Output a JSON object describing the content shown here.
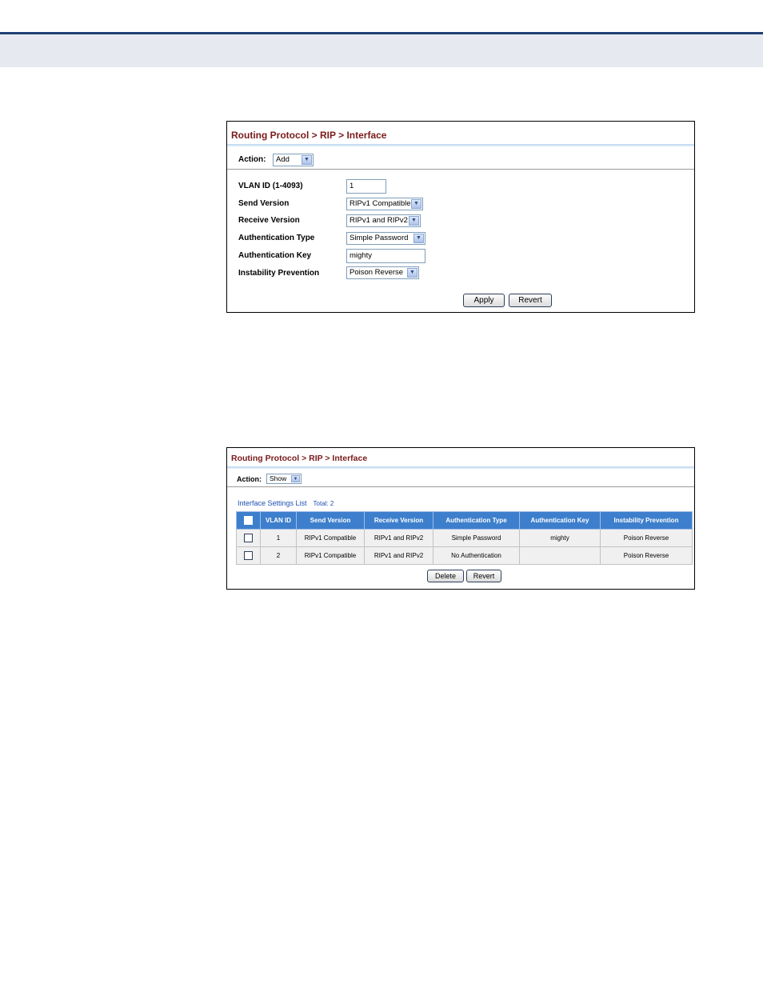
{
  "panel1": {
    "breadcrumb": "Routing Protocol > RIP > Interface",
    "action_label": "Action:",
    "action_value": "Add",
    "fields": {
      "vlan_label": "VLAN ID (1-4093)",
      "vlan_value": "1",
      "send_label": "Send Version",
      "send_value": "RIPv1 Compatible",
      "receive_label": "Receive Version",
      "receive_value": "RIPv1 and RIPv2",
      "auth_type_label": "Authentication Type",
      "auth_type_value": "Simple Password",
      "auth_key_label": "Authentication Key",
      "auth_key_value": "mighty",
      "instability_label": "Instability Prevention",
      "instability_value": "Poison Reverse"
    },
    "apply_label": "Apply",
    "revert_label": "Revert"
  },
  "panel2": {
    "breadcrumb": "Routing Protocol > RIP > Interface",
    "action_label": "Action:",
    "action_value": "Show",
    "list_title": "Interface Settings List",
    "total": "Total: 2",
    "columns": [
      "VLAN ID",
      "Send Version",
      "Receive Version",
      "Authentication Type",
      "Authentication Key",
      "Instability Prevention"
    ],
    "rows": [
      [
        "1",
        "RIPv1 Compatible",
        "RIPv1 and RIPv2",
        "Simple Password",
        "mighty",
        "Poison Reverse"
      ],
      [
        "2",
        "RIPv1 Compatible",
        "RIPv1 and RIPv2",
        "No Authentication",
        "",
        "Poison Reverse"
      ]
    ],
    "delete_label": "Delete",
    "revert_label": "Revert"
  },
  "icons": {
    "dropdown": "chevron-down-icon",
    "checkbox": "checkbox-icon"
  }
}
